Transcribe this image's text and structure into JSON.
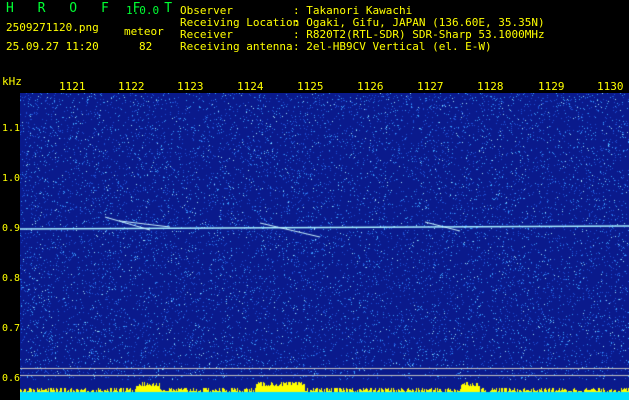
{
  "header": {
    "brand": "H R O F F T",
    "version": "1.0.0",
    "filename": "2509271120.png",
    "mode": "meteor",
    "datetime": "25.09.27 11:20",
    "count": "82",
    "info": [
      {
        "label": "Observer",
        "value": ": Takanori Kawachi"
      },
      {
        "label": "Receiving Location",
        "value": ": Ogaki, Gifu, JAPAN (136.60E, 35.35N)"
      },
      {
        "label": "Receiver",
        "value": ": R820T2(RTL-SDR) SDR-Sharp 53.1000MHz"
      },
      {
        "label": "Receiving antenna",
        "value": ": 2el-HB9CV Vertical (el. E-W)"
      }
    ]
  },
  "time_axis": {
    "labels": [
      "1121",
      "1122",
      "1123",
      "1124",
      "1125",
      "1126",
      "1127",
      "1128",
      "1129",
      "1130"
    ]
  },
  "freq_axis": {
    "unit": "kHz",
    "labels": [
      "1.1",
      "1.0",
      "0.9",
      "0.8",
      "0.7",
      "0.6"
    ],
    "min_khz": 0.6,
    "max_khz": 1.1
  },
  "colors": {
    "background": "#0a1a8c",
    "noise": "#3aa0ff",
    "carrier": "#a8f0ff",
    "label": "#ffff00",
    "brand": "#00ff33",
    "bottom_strip": "#00e0ff",
    "activity": "#ffff00"
  }
}
